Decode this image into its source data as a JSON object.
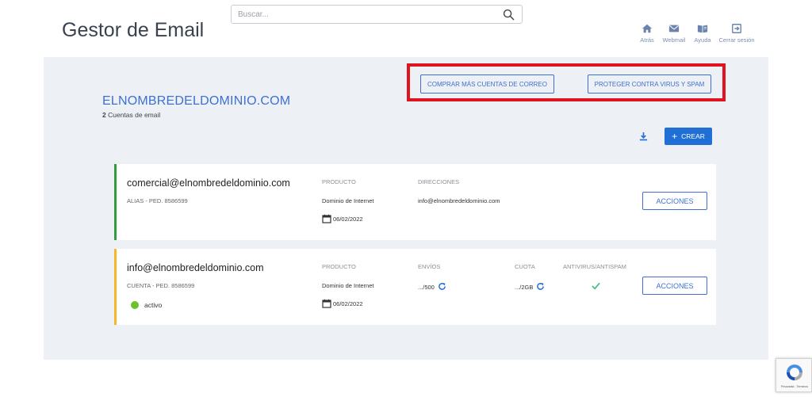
{
  "header": {
    "title": "Gestor de Email",
    "search_placeholder": "Buscar...",
    "nav": [
      {
        "label": "Atrás",
        "icon": "home-icon"
      },
      {
        "label": "Webmail",
        "icon": "mail-icon"
      },
      {
        "label": "Ayuda",
        "icon": "book-icon"
      },
      {
        "label": "Cerrar sesión",
        "icon": "logout-icon"
      }
    ]
  },
  "toolbar": {
    "buy_label": "COMPRAR MÁS CUENTAS DE CORREO",
    "protect_label": "PROTEGER CONTRA VIRUS Y SPAM",
    "create_label": "CREAR"
  },
  "domain": {
    "name": "ELNOMBREDELDOMINIO.COM",
    "count": "2",
    "count_label": "Cuentas de email"
  },
  "accounts": [
    {
      "email": "comercial@elnombredeldominio.com",
      "subtitle": "ALIAS - PED. 8586599",
      "product_head": "PRODUCTO",
      "product": "Dominio de Internet",
      "date": "06/02/2022",
      "addresses_head": "DIRECCIONES",
      "addresses": "info@elnombredeldominio.com",
      "actions_label": "ACCIONES"
    },
    {
      "email": "info@elnombredeldominio.com",
      "subtitle": "CUENTA - PED. 8586599",
      "product_head": "PRODUCTO",
      "product": "Dominio de Internet",
      "date": "06/02/2022",
      "sends_head": "ENVÍOS",
      "sends": ".../500",
      "quota_head": "CUOTA",
      "quota": ".../2GB",
      "antivirus_head": "ANTIVIRUS/ANTISPAM",
      "status": "activo",
      "actions_label": "ACCIONES"
    }
  ],
  "recaptcha": {
    "footer": "Privacidad - Términos"
  },
  "colors": {
    "accent": "#3e6fd1",
    "create_button": "#1f6fd6",
    "highlight": "#e0141e",
    "card1_border": "#2e9d3a",
    "card2_border": "#f7b52c",
    "status_active": "#6bc22c",
    "panel_bg": "#edf1f6"
  }
}
